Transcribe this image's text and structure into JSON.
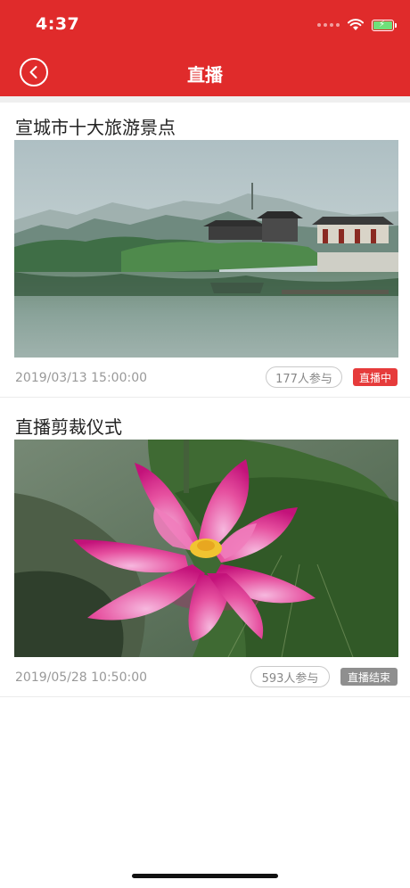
{
  "status_bar": {
    "time": "4:37"
  },
  "nav": {
    "title": "直播"
  },
  "colors": {
    "accent": "#e02b2b",
    "live_badge": "#e63b3b",
    "ended_badge": "#8f8f8f"
  },
  "items": [
    {
      "title": "宣城市十大旅游景点",
      "datetime": "2019/03/13 15:00:00",
      "participants": "177人参与",
      "status": "直播中",
      "status_color": "#e63b3b",
      "image": "misty-lake-temple-landscape"
    },
    {
      "title": "直播剪裁仪式",
      "datetime": "2019/05/28 10:50:00",
      "participants": "593人参与",
      "status": "直播结束",
      "status_color": "#8f8f8f",
      "image": "pink-lotus-flower"
    }
  ]
}
